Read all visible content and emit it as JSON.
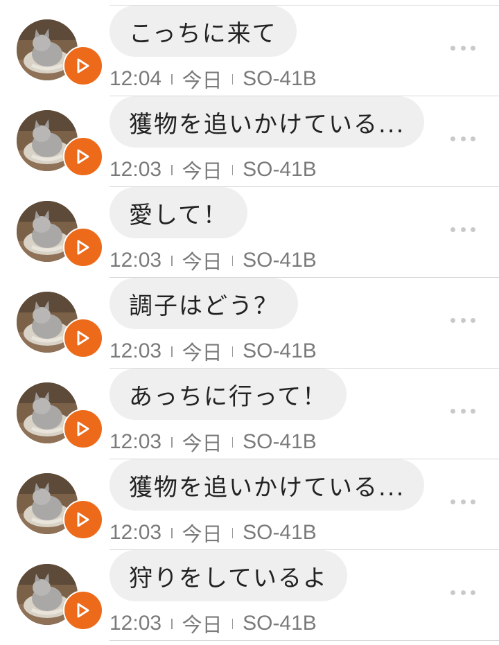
{
  "colors": {
    "bubble_bg": "#efefef",
    "play_badge": "#ec6a1a",
    "meta_text": "#7a7a7a",
    "divider": "#d9d9d9"
  },
  "icons": {
    "play": "play-triangle-outline",
    "more": "three-dots-horizontal"
  },
  "messages": [
    {
      "text": "こっちに来て",
      "time": "12:04",
      "day": "今日",
      "device": "SO-41B"
    },
    {
      "text": "獲物を追いかけている...",
      "time": "12:03",
      "day": "今日",
      "device": "SO-41B"
    },
    {
      "text": "愛して！",
      "time": "12:03",
      "day": "今日",
      "device": "SO-41B"
    },
    {
      "text": "調子はどう？",
      "time": "12:03",
      "day": "今日",
      "device": "SO-41B"
    },
    {
      "text": "あっちに行って！",
      "time": "12:03",
      "day": "今日",
      "device": "SO-41B"
    },
    {
      "text": "獲物を追いかけている...",
      "time": "12:03",
      "day": "今日",
      "device": "SO-41B"
    },
    {
      "text": "狩りをしているよ",
      "time": "12:03",
      "day": "今日",
      "device": "SO-41B"
    }
  ]
}
